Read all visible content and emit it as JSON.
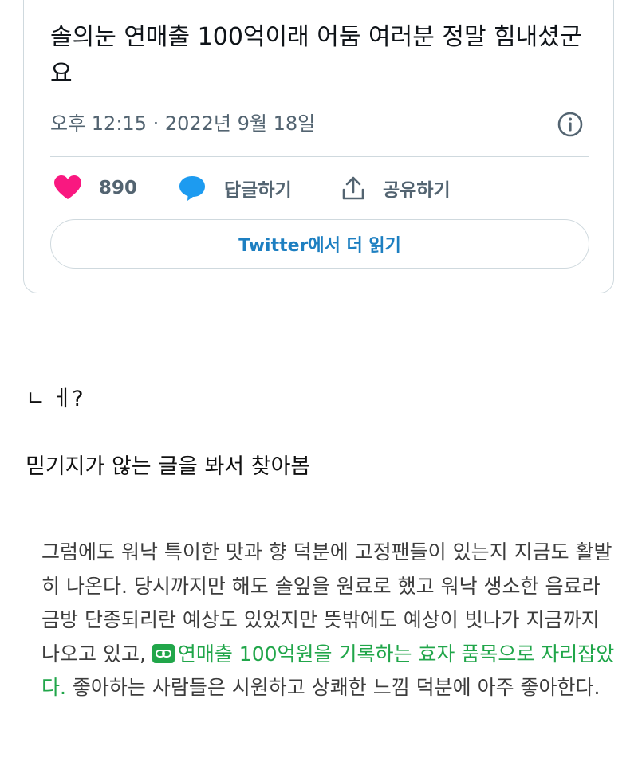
{
  "tweet": {
    "text": "솔의눈 연매출 100억이래 어둠 여러분 정말 힘내셨군요",
    "timestamp": "오후 12:15 · 2022년 9월 18일",
    "like_count": "890",
    "reply_label": "답글하기",
    "share_label": "공유하기",
    "read_more_label": "Twitter에서 더 읽기",
    "like_color": "#f91880",
    "reply_color": "#1d9bf0",
    "link_color": "#1d7fc1"
  },
  "body": {
    "line1": "ㄴ ㅔ?",
    "line2": "믿기지가 않는 글을 봐서 찾아봄"
  },
  "quote": {
    "text_before": "그럼에도 워낙 특이한 맛과 향 덕분에 고정팬들이 있는지 지금도 활발히 나온다. 당시까지만 해도 솔잎을 원료로 했고 워낙 생소한 음료라 금방 단종되리란 예상도 있었지만 뜻밖에도 예상이 빗나가 지금까지 나오고 있고, ",
    "link_text": "연매출 100억원을 기록하는 효자 품목으로 자리잡았다.",
    "text_after": " 좋아하는 사람들은 시원하고 상쾌한 느낌 덕분에 아주 좋아한다.",
    "link_color": "#21a64a"
  }
}
